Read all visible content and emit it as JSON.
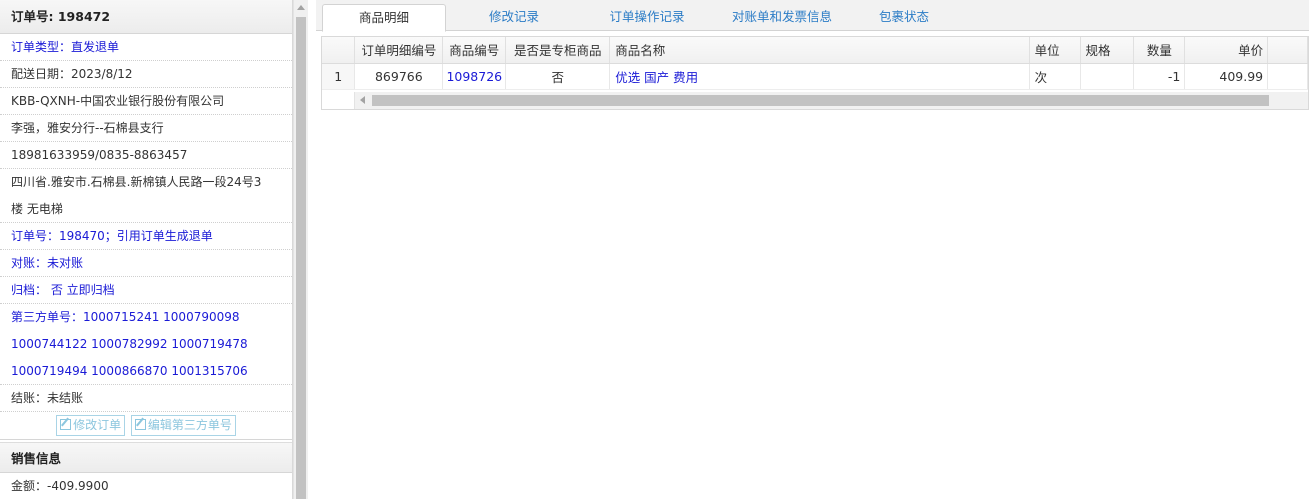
{
  "order_panel": {
    "header": "订单号: 198472",
    "rows": [
      {
        "text": "订单类型：直发退单",
        "color": "blue"
      },
      {
        "text": "配送日期：2023/8/12",
        "color": "dark"
      },
      {
        "text": "KBB-QXNH-中国农业银行股份有限公司",
        "color": "dark"
      },
      {
        "text": "李强，雅安分行--石棉县支行",
        "color": "dark"
      },
      {
        "text": "18981633959/0835-8863457",
        "color": "dark"
      }
    ],
    "address_line1": "四川省.雅安市.石棉县.新棉镇人民路一段24号3",
    "address_line2": "楼 无电梯",
    "order_ref": "订单号：198470；引用订单生成退单",
    "reconcile": "对账：未对账",
    "archive": "归档：  否 立即归档",
    "third_party_line1": "第三方单号：1000715241 1000790098",
    "third_party_line2": "1000744122 1000782992 1000719478",
    "third_party_line3": "1000719494 1000866870 1001315706",
    "settlement": "结账：未结账",
    "edit_order_label": "修改订单",
    "edit_third_party_label": "编辑第三方单号"
  },
  "sales_panel": {
    "header": "销售信息",
    "amount": "金额：-409.9900"
  },
  "tabs": [
    {
      "label": "商品明细",
      "active": true
    },
    {
      "label": "修改记录",
      "active": false
    },
    {
      "label": "订单操作记录",
      "active": false
    },
    {
      "label": "对账单和发票信息",
      "active": false
    },
    {
      "label": "包裹状态",
      "active": false
    }
  ],
  "table": {
    "headers": {
      "detail_no": "订单明细编号",
      "product_no": "商品编号",
      "is_counter": "是否是专柜商品",
      "product_name": "商品名称",
      "unit": "单位",
      "spec": "规格",
      "qty": "数量",
      "price": "单价"
    },
    "rows": [
      {
        "row_num": "1",
        "detail_no": "869766",
        "product_no": "1098726",
        "is_counter": "否",
        "product_name": "优选 国产 费用",
        "unit": "次",
        "spec": "",
        "qty": "-1",
        "price": "409.99"
      }
    ]
  },
  "colors": {
    "link_blue": "#1a1ad6",
    "tab_blue": "#2b7cc6",
    "disabled_button": "#8cc6de"
  }
}
